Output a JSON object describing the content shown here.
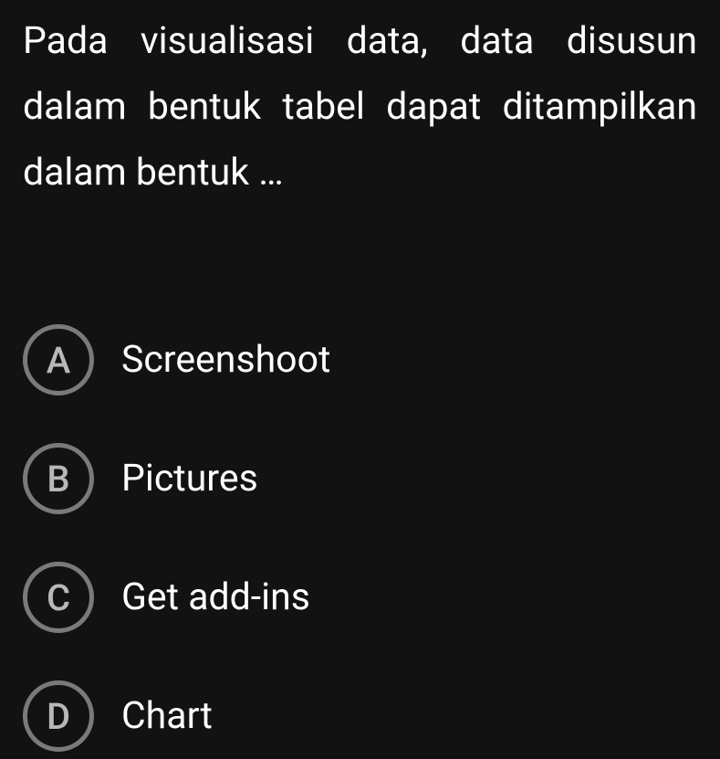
{
  "question": {
    "text": "Pada visualisasi data, data disusun dalam bentuk tabel dapat ditampilkan dalam bentuk …"
  },
  "options": [
    {
      "letter": "A",
      "text": "Screenshoot"
    },
    {
      "letter": "B",
      "text": "Pictures"
    },
    {
      "letter": "C",
      "text": "Get add-ins"
    },
    {
      "letter": "D",
      "text": "Chart"
    }
  ]
}
